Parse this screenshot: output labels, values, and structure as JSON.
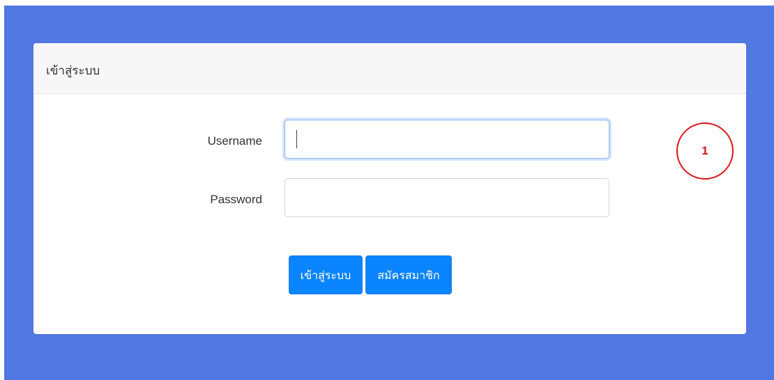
{
  "card": {
    "title": "เข้าสู่ระบบ"
  },
  "form": {
    "username_label": "Username",
    "password_label": "Password",
    "username_value": "",
    "password_value": ""
  },
  "buttons": {
    "login_label": "เข้าสู่ระบบ",
    "register_label": "สมัครสมาชิก"
  },
  "annotation": {
    "marker_number": "1"
  },
  "colors": {
    "background": "#5177e0",
    "primary_button": "#0a84ff",
    "marker": "#e0151b"
  }
}
